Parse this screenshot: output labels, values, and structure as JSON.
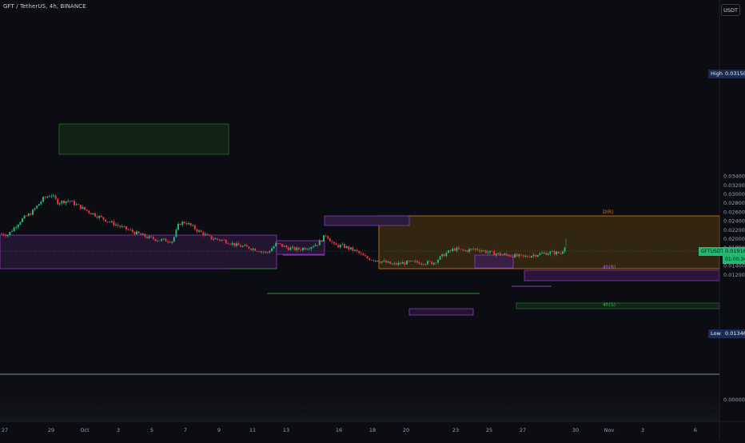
{
  "header": {
    "title": "GFT / TetherUS, 4h, BINANCE",
    "currency": "USDT"
  },
  "price_axis": {
    "high_label": "High",
    "high_value": "0.03150",
    "low_label": "Low",
    "low_value": "0.01346",
    "symbol_tag": "GFTUSDT",
    "last_price": "0.01916",
    "countdown": "01:00:34"
  },
  "colors": {
    "background": "#0c0d12",
    "bull": "#26b673",
    "bear": "#e5333d",
    "zone_green": "#2e6b35",
    "zone_purple": "#8a3bc0",
    "zone_orange": "#d57c1e",
    "high_low_tag": "#1a2a52"
  },
  "chart_data": {
    "type": "candlestick",
    "y_ticks": [
      "0.03400",
      "0.03200",
      "0.03000",
      "0.02800",
      "0.02600",
      "0.02400",
      "0.02200",
      "0.02000",
      "0.01800",
      "0.01600",
      "0.01400",
      "0.01200",
      "0.00000"
    ],
    "x_ticks": [
      "27",
      "29",
      "Oct",
      "3",
      "5",
      "7",
      "9",
      "11",
      "13",
      "16",
      "18",
      "20",
      "23",
      "25",
      "27",
      "30",
      "Nov",
      "3",
      "6"
    ],
    "ylim": [
      0.0115,
      0.0355
    ],
    "high": 0.0315,
    "low": 0.01346,
    "last": 0.01916,
    "zone_labels": {
      "daily": "D(R)",
      "four_hour": "4h(R)",
      "h1_support": "4h(S)"
    },
    "anchors": [
      [
        0,
        0.0212
      ],
      [
        10,
        0.021
      ],
      [
        26,
        0.0242
      ],
      [
        40,
        0.026
      ],
      [
        54,
        0.029
      ],
      [
        64,
        0.03
      ],
      [
        72,
        0.0282
      ],
      [
        86,
        0.0286
      ],
      [
        96,
        0.0276
      ],
      [
        110,
        0.0262
      ],
      [
        126,
        0.0248
      ],
      [
        140,
        0.0236
      ],
      [
        154,
        0.0225
      ],
      [
        172,
        0.0212
      ],
      [
        186,
        0.0203
      ],
      [
        200,
        0.0198
      ],
      [
        216,
        0.0196
      ],
      [
        224,
        0.0235
      ],
      [
        232,
        0.0238
      ],
      [
        248,
        0.0218
      ],
      [
        264,
        0.0202
      ],
      [
        280,
        0.0197
      ],
      [
        296,
        0.0186
      ],
      [
        314,
        0.018
      ],
      [
        334,
        0.0169
      ],
      [
        346,
        0.019
      ],
      [
        360,
        0.018
      ],
      [
        372,
        0.0177
      ],
      [
        386,
        0.0182
      ],
      [
        398,
        0.019
      ],
      [
        408,
        0.021
      ],
      [
        418,
        0.0186
      ],
      [
        430,
        0.0184
      ],
      [
        446,
        0.0172
      ],
      [
        458,
        0.0158
      ],
      [
        474,
        0.0152
      ],
      [
        492,
        0.0143
      ],
      [
        506,
        0.0147
      ],
      [
        522,
        0.0148
      ],
      [
        542,
        0.0147
      ],
      [
        556,
        0.0166
      ],
      [
        568,
        0.0178
      ],
      [
        580,
        0.0174
      ],
      [
        596,
        0.0178
      ],
      [
        612,
        0.017
      ],
      [
        626,
        0.0166
      ],
      [
        642,
        0.0163
      ],
      [
        656,
        0.016
      ],
      [
        674,
        0.0167
      ],
      [
        690,
        0.017
      ],
      [
        702,
        0.0168
      ],
      [
        708,
        0.0191
      ]
    ]
  }
}
